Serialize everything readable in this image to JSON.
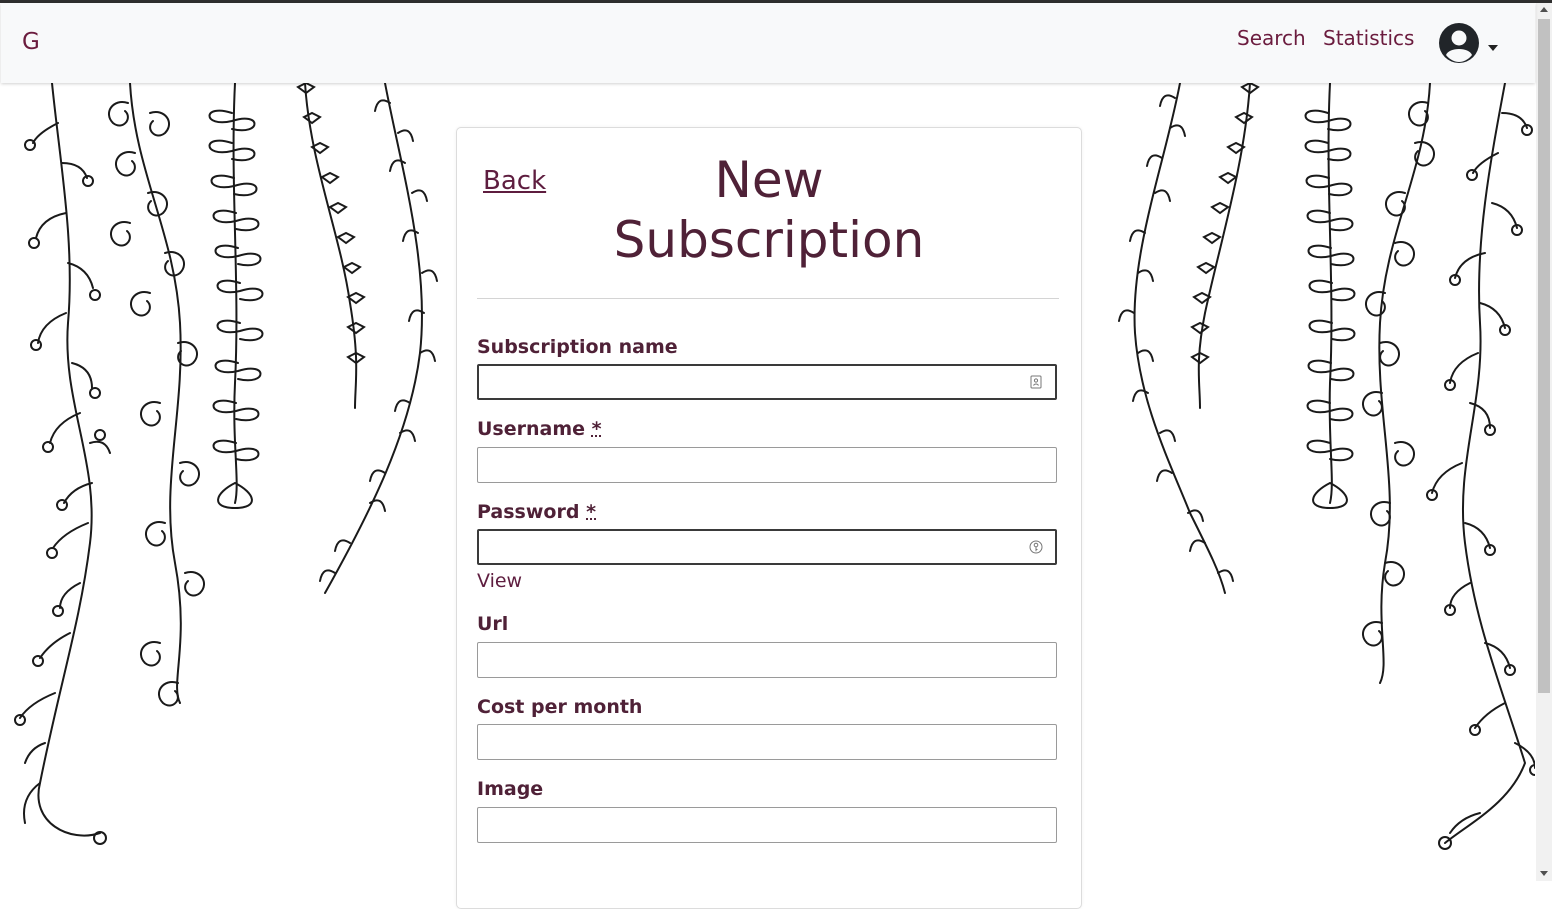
{
  "navbar": {
    "brand": "G",
    "links": {
      "search": "Search",
      "statistics": "Statistics"
    }
  },
  "form": {
    "back_label": "Back",
    "title": "New Subscription",
    "fields": {
      "subscription_name": {
        "label": "Subscription name",
        "value": ""
      },
      "username": {
        "label": "Username",
        "required_mark": "*",
        "value": ""
      },
      "password": {
        "label": "Password",
        "required_mark": "*",
        "value": "",
        "view_label": "View"
      },
      "url": {
        "label": "Url",
        "value": ""
      },
      "cost_per_month": {
        "label": "Cost per month",
        "value": ""
      },
      "image": {
        "label": "Image",
        "value": ""
      }
    }
  },
  "colors": {
    "accent": "#6b1c3e",
    "title": "#4f2137",
    "navbar_bg": "#f8f9fa"
  }
}
